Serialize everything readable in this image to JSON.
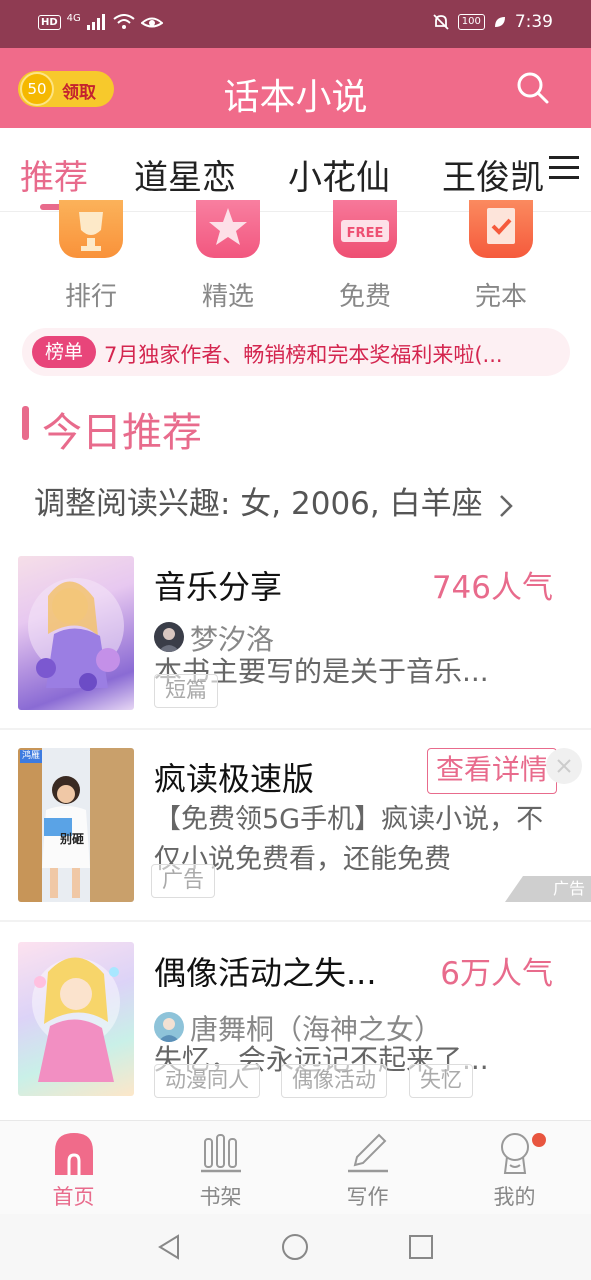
{
  "status_bar": {
    "left_hd": "HD",
    "left_network": "4G",
    "battery": "100",
    "time": "7:39"
  },
  "header": {
    "coin_amount": "50",
    "coin_label": "领取",
    "title": "话本小说",
    "search_icon": "search-icon"
  },
  "tabs": [
    {
      "label": "推荐",
      "active": true
    },
    {
      "label": "道星恋",
      "active": false
    },
    {
      "label": "小花仙",
      "active": false
    },
    {
      "label": "王俊凯",
      "active": false
    }
  ],
  "categories": [
    {
      "label": "排行",
      "icon": "trophy-icon",
      "color": "#f9923a"
    },
    {
      "label": "精选",
      "icon": "star-icon",
      "color": "#f2577f"
    },
    {
      "label": "免费",
      "icon": "free-tag-icon",
      "color": "#ee4f72"
    },
    {
      "label": "完本",
      "icon": "check-doc-icon",
      "color": "#f55a3c"
    }
  ],
  "notice": {
    "badge": "榜单",
    "text": "7月独家作者、畅销榜和完本奖福利来啦(..."
  },
  "section": {
    "title": "今日推荐",
    "preferences": "调整阅读兴趣: 女, 2006, 白羊座"
  },
  "books": [
    {
      "title": "音乐分享",
      "popularity": "746人气",
      "author": "梦汐洛",
      "description": "本书主要写的是关于音乐...",
      "tags": [
        "短篇"
      ]
    },
    {
      "title": "偶像活动之失...",
      "popularity": "6万人气",
      "author": "唐舞桐（海神之女）",
      "description": "失忆，会永远记不起来了...",
      "tags": [
        "动漫同人",
        "偶像活动",
        "失忆"
      ]
    }
  ],
  "ad": {
    "title": "疯读极速版",
    "button": "查看详情",
    "description": "【免费领5G手机】疯读小说，不仅小说免费看，还能免费",
    "tag": "广告",
    "mark": "广告",
    "cover_logo": "鸿雁",
    "cover_caption": "别砸"
  },
  "bottom_nav": [
    {
      "label": "首页",
      "icon": "home-icon",
      "active": true
    },
    {
      "label": "书架",
      "icon": "bookshelf-icon",
      "active": false
    },
    {
      "label": "写作",
      "icon": "pen-icon",
      "active": false
    },
    {
      "label": "我的",
      "icon": "profile-icon",
      "active": false
    }
  ],
  "colors": {
    "accent": "#e86b8c",
    "header_bg": "#f06b8a",
    "status_bg": "#8f3b52"
  }
}
